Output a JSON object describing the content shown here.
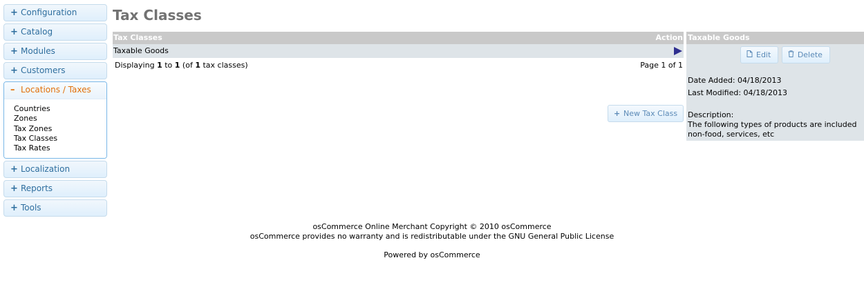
{
  "sidebar": {
    "groups": [
      {
        "label": "Configuration",
        "sign": "+"
      },
      {
        "label": "Catalog",
        "sign": "+"
      },
      {
        "label": "Modules",
        "sign": "+"
      },
      {
        "label": "Customers",
        "sign": "+"
      },
      {
        "label": "Locations / Taxes",
        "sign": "–",
        "items": [
          "Countries",
          "Zones",
          "Tax Zones",
          "Tax Classes",
          "Tax Rates"
        ]
      },
      {
        "label": "Localization",
        "sign": "+"
      },
      {
        "label": "Reports",
        "sign": "+"
      },
      {
        "label": "Tools",
        "sign": "+"
      }
    ]
  },
  "page": {
    "title": "Tax Classes"
  },
  "table": {
    "headers": {
      "name": "Tax Classes",
      "action": "Action"
    },
    "rows": [
      {
        "name": "Taxable Goods"
      }
    ],
    "display": {
      "prefix": "Displaying ",
      "from": "1",
      "to_word": " to ",
      "to": "1",
      "of_open": " (of ",
      "total": "1",
      "suffix": " tax classes)"
    },
    "paging": "Page 1 of 1",
    "new_button": "New Tax Class"
  },
  "info": {
    "title": "Taxable Goods",
    "edit_label": "Edit",
    "delete_label": "Delete",
    "date_added": "Date Added: 04/18/2013",
    "last_modified": "Last Modified: 04/18/2013",
    "description_label": "Description:",
    "description_line1": "The following types of products are included",
    "description_line2": "non-food, services, etc"
  },
  "footer": {
    "copyright": "osCommerce Online Merchant Copyright © 2010 osCommerce",
    "warranty": "osCommerce provides no warranty and is redistributable under the GNU General Public License",
    "powered": "Powered by osCommerce"
  },
  "icons": {
    "expand": "plus-icon",
    "collapse": "minus-icon",
    "row_action": "play-arrow-icon",
    "edit": "document-icon",
    "delete": "trash-icon",
    "new": "plus-icon"
  }
}
